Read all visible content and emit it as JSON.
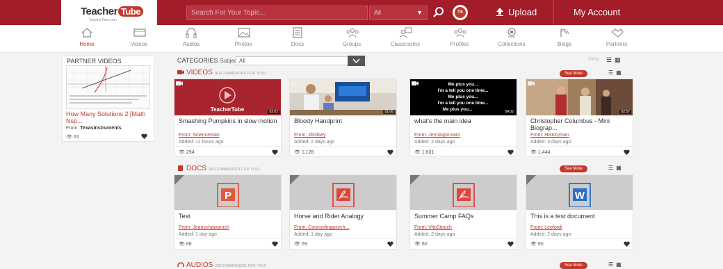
{
  "header": {
    "logo_text": "Teacher",
    "logo_tube": "Tube",
    "logo_sub": "TeacherTube.com",
    "search_placeholder": "Search For Your Topic...",
    "filter_value": "All",
    "ts_badge": "TS",
    "upload_label": "Upload",
    "account_label": "My Account",
    "brand_color": "#a31c2a"
  },
  "nav": {
    "items": [
      {
        "label": "Home",
        "icon": "home-icon",
        "active": true
      },
      {
        "label": "Videos",
        "icon": "videos-icon"
      },
      {
        "label": "Audios",
        "icon": "headphones-icon"
      },
      {
        "label": "Photos",
        "icon": "photos-icon"
      },
      {
        "label": "Docs",
        "icon": "docs-icon"
      },
      {
        "label": "Groups",
        "icon": "groups-icon"
      },
      {
        "label": "Classrooms",
        "icon": "classrooms-icon"
      },
      {
        "label": "Profiles",
        "icon": "profiles-icon"
      },
      {
        "label": "Collections",
        "icon": "collections-icon"
      },
      {
        "label": "Blogs",
        "icon": "blogs-icon"
      },
      {
        "label": "Partners",
        "icon": "partners-icon"
      }
    ]
  },
  "sidebar": {
    "title": "PARTNER VIDEOS",
    "video_title": "How Many Solutions 2 [Math Nsp...",
    "from_label": "From:",
    "from_value": "TexasInstruments",
    "views": "65"
  },
  "categories": {
    "label": "CATEGORIES",
    "subject_label": "Subject:",
    "subject_value": "All",
    "view_label": "View:"
  },
  "videos_section": {
    "title": "VIDEOS",
    "recommended": "(RECOMMENDED FOR YOU)",
    "see_more": "See More",
    "items": [
      {
        "title": "Smashing Pumpkins in slow motion",
        "from": "From: Scienceman",
        "added": "Added: 11 hours ago",
        "views": "294",
        "duration": "02:02",
        "thumb_text": "TeacherTube"
      },
      {
        "title": "Bloody Handprint",
        "from": "From: Jlindsey",
        "added": "Added: 2 days ago",
        "views": "1,128",
        "duration": "01:06"
      },
      {
        "title": "what's the main idea",
        "from": "From: JenningsLearn",
        "added": "Added: 2 days ago",
        "views": "1,601",
        "duration": "04:02",
        "thumb_lines": [
          "Me plus you...",
          "I'm a tell you one time...",
          "Me plus you...",
          "I'm a tell you one time...",
          "Me plus you..."
        ]
      },
      {
        "title": "Christopher Columbus - Mini Biograp...",
        "from": "From: Historyman",
        "added": "Added: 3 days ago",
        "views": "1,444",
        "duration": "02:57"
      }
    ]
  },
  "docs_section": {
    "title": "DOCS",
    "recommended": "(RECOMMENDED FOR YOU)",
    "see_more": "See More",
    "items": [
      {
        "title": "Test",
        "from": "From: Jeanschawaroch",
        "added": "Added: 1 day ago",
        "views": "68",
        "icon": "powerpoint-icon",
        "letter": "P"
      },
      {
        "title": "Horse and Rider Analogy",
        "from": "From: Counselingpsych...",
        "added": "Added: 1 day ago",
        "views": "59",
        "icon": "pdf-icon"
      },
      {
        "title": "Summer Camp FAQs",
        "from": "From: VitoStouch",
        "added": "Added: 2 days ago",
        "views": "60",
        "icon": "pdf-icon"
      },
      {
        "title": "This is a test document",
        "from": "From: Leofordi",
        "added": "Added: 2 days ago",
        "views": "80",
        "icon": "word-icon",
        "letter": "W"
      }
    ]
  },
  "audios_section": {
    "title": "AUDIOS",
    "recommended": "(RECOMMENDED FOR YOU)",
    "see_more": "See More"
  }
}
